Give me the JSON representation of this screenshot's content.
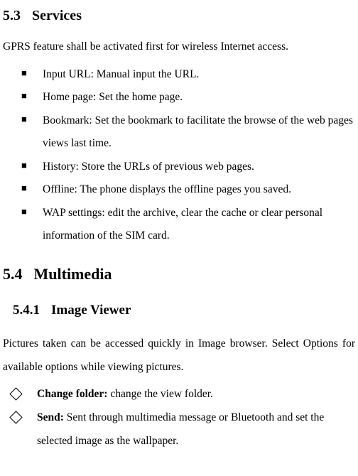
{
  "section53": {
    "num": "5.3",
    "title": "Services",
    "intro": "GPRS feature shall be activated first for wireless Internet access.",
    "items": [
      "Input URL: Manual input the URL.",
      "Home page: Set the home page.",
      "Bookmark: Set the bookmark to facilitate the browse of the web pages views last time.",
      "History: Store the URLs of previous web pages.",
      "Offline: The phone displays the offline pages you saved.",
      "WAP settings: edit the archive, clear the cache or clear personal information of the SIM card."
    ]
  },
  "section54": {
    "num": "5.4",
    "title": "Multimedia"
  },
  "section541": {
    "num": "5.4.1",
    "title": "Image Viewer",
    "intro": "Pictures taken can be accessed quickly in Image browser. Select Options for available options while viewing pictures.",
    "items": [
      {
        "label": "Change folder:",
        "text": " change the view folder."
      },
      {
        "label": "Send:",
        "text": " Sent through multimedia message or Bluetooth and set the selected image as the wallpaper."
      }
    ]
  }
}
